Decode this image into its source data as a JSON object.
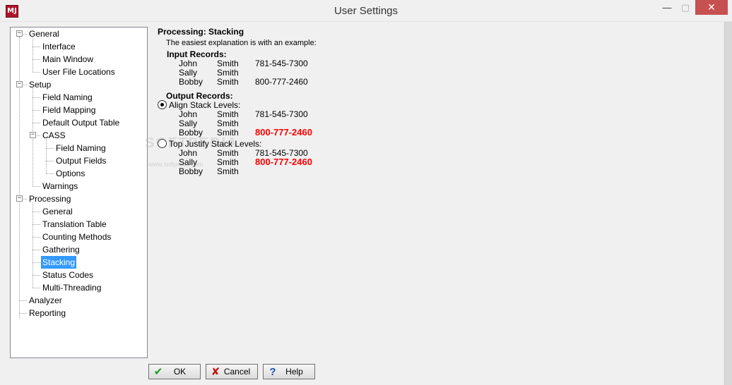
{
  "window": {
    "title": "User Settings",
    "app_icon_text": "MJ",
    "minimize_glyph": "—",
    "maximize_glyph": "▢",
    "close_glyph": "✕"
  },
  "tree": {
    "expanded_glyph": "−",
    "nodes": [
      {
        "label": "General",
        "expander": true
      },
      {
        "label": "Interface"
      },
      {
        "label": "Main Window"
      },
      {
        "label": "User File Locations"
      },
      {
        "label": "Setup",
        "expander": true
      },
      {
        "label": "Field Naming"
      },
      {
        "label": "Field Mapping"
      },
      {
        "label": "Default Output Table"
      },
      {
        "label": "CASS",
        "expander": true
      },
      {
        "label": "Field Naming"
      },
      {
        "label": "Output Fields"
      },
      {
        "label": "Options"
      },
      {
        "label": "Warnings"
      },
      {
        "label": "Processing",
        "expander": true
      },
      {
        "label": "General"
      },
      {
        "label": "Translation Table"
      },
      {
        "label": "Counting Methods"
      },
      {
        "label": "Gathering"
      },
      {
        "label": "Stacking",
        "selected": true
      },
      {
        "label": "Status Codes"
      },
      {
        "label": "Multi-Threading"
      },
      {
        "label": "Analyzer"
      },
      {
        "label": "Reporting"
      }
    ]
  },
  "content": {
    "heading": "Processing:  Stacking",
    "intro": "The easiest explanation is with an example:",
    "input_title": "Input  Records:",
    "input_rows": [
      [
        "John",
        "Smith",
        "781-545-7300"
      ],
      [
        "Sally",
        "Smith",
        ""
      ],
      [
        "Bobby",
        "Smith",
        "800-777-2460"
      ]
    ],
    "output_title": "Output  Records:",
    "align_label": "Align Stack Levels:",
    "align_rows": [
      [
        "John",
        "Smith",
        "781-545-7300"
      ],
      [
        "Sally",
        "Smith",
        ""
      ],
      [
        "Bobby",
        "Smith",
        "800-777-2460"
      ]
    ],
    "top_label": "Top Justify Stack Levels:",
    "top_rows": [
      [
        "John",
        "Smith",
        "781-545-7300"
      ],
      [
        "Sally",
        "Smith",
        "800-777-2460"
      ],
      [
        "Bobby",
        "Smith",
        ""
      ]
    ],
    "align_selected": true,
    "watermark": "SOFTPEDIA",
    "watermark_url": "www.softpedia.com"
  },
  "buttons": {
    "ok": {
      "label": "OK",
      "icon": "✔"
    },
    "cancel": {
      "label": "Cancel",
      "icon": "✘"
    },
    "help": {
      "label": "Help",
      "icon": "?"
    }
  },
  "colors": {
    "selection": "#3399ff",
    "highlight_red": "#ff0000",
    "close_button": "#c75050"
  }
}
